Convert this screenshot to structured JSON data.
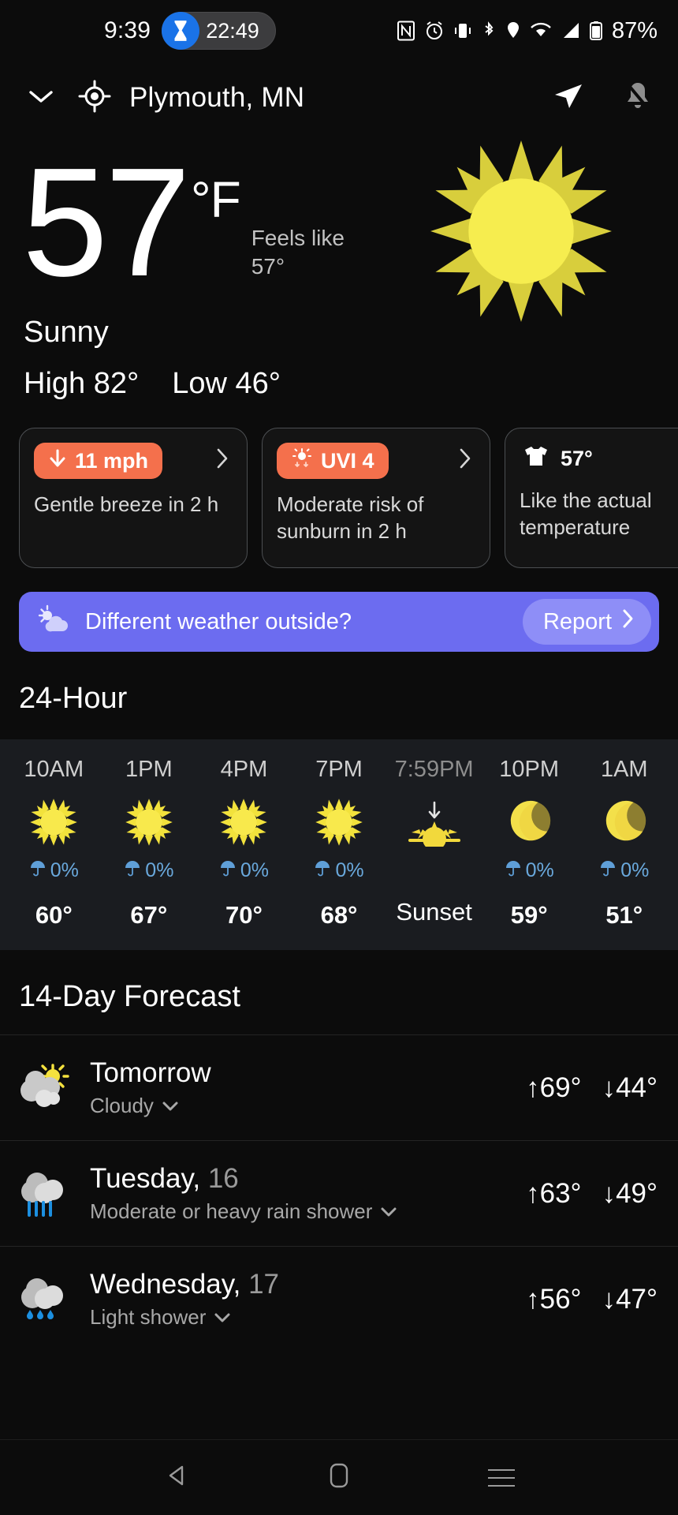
{
  "status_bar": {
    "clock": "9:39",
    "timer_chip": {
      "icon": "hourglass-icon",
      "value": "22:49"
    },
    "icons": [
      "nfc-icon",
      "alarm-icon",
      "vibrate-icon",
      "bluetooth-icon",
      "location-icon",
      "wifi-icon",
      "cellular-signal-icon",
      "battery-icon"
    ],
    "battery_percent": "87%"
  },
  "app_bar": {
    "expand_icon": "chevron-down-icon",
    "location_icon": "my-location-icon",
    "location": "Plymouth, MN",
    "share_icon": "send-icon",
    "notifications_icon": "bell-off-icon"
  },
  "current": {
    "temperature": "57",
    "unit": "°F",
    "feels_like_label": "Feels like",
    "feels_like_value": "57°",
    "condition": "Sunny",
    "high": "High 82°",
    "low": "Low 46°",
    "icon": "sun-icon"
  },
  "info_cards": [
    {
      "id": "wind",
      "icon": "arrow-down-icon",
      "badge": "11 mph",
      "badge_style": "orange",
      "chevron": "chevron-right-icon",
      "caption": "Gentle breeze in 2 h"
    },
    {
      "id": "uv-index",
      "icon": "uv-sun-icon",
      "badge": "UVI 4",
      "badge_style": "orange",
      "chevron": "chevron-right-icon",
      "caption": "Moderate risk of sunburn in 2 h"
    },
    {
      "id": "clothing",
      "icon": "tshirt-icon",
      "badge": "57°",
      "badge_style": "plain",
      "chevron": "",
      "caption": "Like the actual temperature"
    }
  ],
  "report_banner": {
    "icon": "partly-cloudy-icon",
    "text": "Different weather outside?",
    "button_label": "Report",
    "button_icon": "chevron-right-icon",
    "color": "#6c6cf0",
    "button_color": "#8e8ef7"
  },
  "hourly": {
    "title": "24-Hour",
    "items": [
      {
        "time": "10AM",
        "icon": "sun-icon",
        "pop": "0%",
        "temp": "60°",
        "dim": false
      },
      {
        "time": "1PM",
        "icon": "sun-icon",
        "pop": "0%",
        "temp": "67°",
        "dim": false
      },
      {
        "time": "4PM",
        "icon": "sun-icon",
        "pop": "0%",
        "temp": "70°",
        "dim": false
      },
      {
        "time": "7PM",
        "icon": "sun-icon",
        "pop": "0%",
        "temp": "68°",
        "dim": false
      },
      {
        "time": "7:59PM",
        "icon": "sunset-icon",
        "pop": "",
        "temp": "Sunset",
        "dim": true
      },
      {
        "time": "10PM",
        "icon": "moon-icon",
        "pop": "0%",
        "temp": "59°",
        "dim": false
      },
      {
        "time": "1AM",
        "icon": "moon-icon",
        "pop": "0%",
        "temp": "51°",
        "dim": false
      }
    ]
  },
  "daily": {
    "title": "14-Day Forecast",
    "items": [
      {
        "icon": "cloudy-sun-icon",
        "name": "Tomorrow",
        "date": "",
        "condition": "Cloudy",
        "expand_icon": "chevron-down-icon",
        "high": "↑69°",
        "low": "↓44°"
      },
      {
        "icon": "heavy-rain-icon",
        "name": "Tuesday,",
        "date": "16",
        "condition": "Moderate or heavy rain shower",
        "expand_icon": "chevron-down-icon",
        "high": "↑63°",
        "low": "↓49°"
      },
      {
        "icon": "light-shower-icon",
        "name": "Wednesday,",
        "date": "17",
        "condition": "Light shower",
        "expand_icon": "chevron-down-icon",
        "high": "↑56°",
        "low": "↓47°"
      }
    ]
  },
  "nav_bar": {
    "back": "back-icon",
    "home": "home-icon",
    "recents": "recents-icon"
  }
}
